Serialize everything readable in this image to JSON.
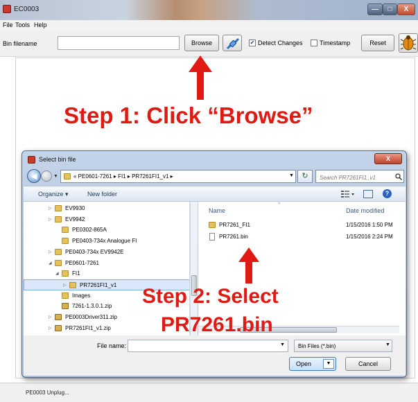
{
  "window": {
    "title": "EC0003",
    "min_glyph": "—",
    "max_glyph": "□",
    "close_glyph": "X"
  },
  "menu": [
    "File",
    "Tools",
    "Help"
  ],
  "toolbar": {
    "bin_label": "Bin filename",
    "bin_value": "",
    "browse_label": "Browse",
    "detect_label": "Detect Changes",
    "detect_checked": true,
    "timestamp_label": "Timestamp",
    "timestamp_checked": false,
    "reset_label": "Reset"
  },
  "status": {
    "text": "PE0003 Unplug..."
  },
  "annotations": {
    "step1": "Step 1: Click “Browse”",
    "step2_line1": "Step 2: Select",
    "step2_line2": "PR7261.bin"
  },
  "dialog": {
    "title": "Select bin file",
    "close_glyph": "X",
    "back_glyph": "◀",
    "address": "« PE0601-7261 ▸ FI1 ▸ PR7261FI1_v1 ▸",
    "refresh_glyph": "↻",
    "search_placeholder": "Search PR7261FI1_v1",
    "organize_label": "Organize ▾",
    "new_folder_label": "New folder",
    "help_glyph": "?",
    "tree": [
      {
        "label": "EV9930",
        "twisty": "▷",
        "kind": "folder"
      },
      {
        "label": "EV9942",
        "twisty": "▷",
        "kind": "folder"
      },
      {
        "label": "PE0302-865A",
        "twisty": "",
        "kind": "folder"
      },
      {
        "label": "PE0403-734x Analogue FI",
        "twisty": "",
        "kind": "folder"
      },
      {
        "label": "PE0403-734x EV9942E",
        "twisty": "▷",
        "kind": "folder"
      },
      {
        "label": "PE0601-7261",
        "twisty": "◢",
        "kind": "folder"
      },
      {
        "label": "FI1",
        "twisty": "◢",
        "kind": "folder"
      },
      {
        "label": "PR7261FI1_v1",
        "twisty": "▷",
        "kind": "folder",
        "selected": true
      },
      {
        "label": "Images",
        "twisty": "",
        "kind": "folder"
      },
      {
        "label": "7261-1.3.0.1.zip",
        "twisty": "",
        "kind": "zip"
      },
      {
        "label": "PE0003Driver311.zip",
        "twisty": "▷",
        "kind": "zip"
      },
      {
        "label": "PR7261FI1_v1.zip",
        "twisty": "▷",
        "kind": "zip"
      }
    ],
    "columns": {
      "name": "Name",
      "date": "Date modified"
    },
    "files": [
      {
        "name": "PR7261_FI1",
        "date": "1/15/2016 1:50 PM",
        "kind": "folder"
      },
      {
        "name": "PR7261.bin",
        "date": "1/15/2016 2:24 PM",
        "kind": "file"
      }
    ],
    "file_name_label": "File name:",
    "file_name_value": "",
    "filter_value": "Bin Files (*.bin)",
    "open_label": "Open",
    "cancel_label": "Cancel"
  },
  "colors": {
    "annotation_red": "#e01a12",
    "accent_blue": "#3a78c8"
  }
}
